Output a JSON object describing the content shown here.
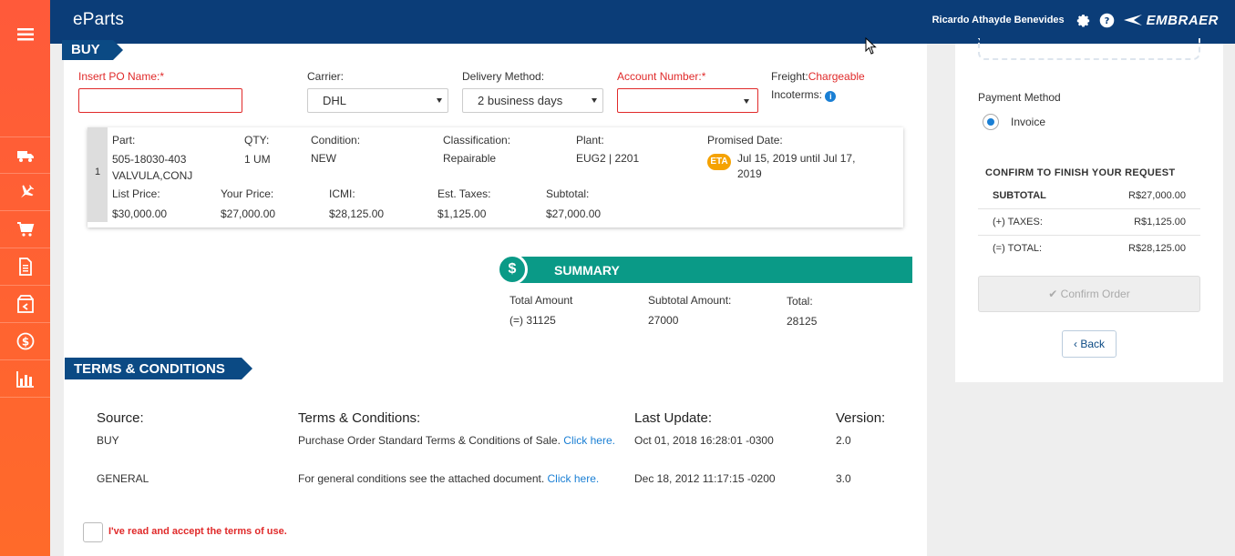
{
  "header": {
    "brand": "eParts",
    "user_name": "Ricardo Athayde Benevides",
    "company": "EMBRAER"
  },
  "sidebar": {
    "items": [
      {
        "icon": "menu-icon"
      },
      {
        "icon": "truck-icon"
      },
      {
        "icon": "airplane-icon"
      },
      {
        "icon": "cart-icon"
      },
      {
        "icon": "document-icon"
      },
      {
        "icon": "return-box-icon"
      },
      {
        "icon": "dollar-icon"
      },
      {
        "icon": "bar-chart-icon"
      }
    ]
  },
  "buy": {
    "section_title": "BUY",
    "po_label": "Insert PO Name:*",
    "po_value": "",
    "carrier_label": "Carrier:",
    "carrier_value": "DHL",
    "delivery_label": "Delivery Method:",
    "delivery_value": "2 business days",
    "account_label": "Account Number:*",
    "account_value": "",
    "freight_label": "Freight:",
    "freight_value": "Chargeable",
    "incoterms_label": "Incoterms:"
  },
  "part": {
    "index": "1",
    "part_label": "Part:",
    "part_number": "505-18030-403",
    "part_name": "VALVULA,CONJ",
    "qty_label": "QTY:",
    "qty_value": "1 UM",
    "condition_label": "Condition:",
    "condition_value": "NEW",
    "classification_label": "Classification:",
    "classification_value": "Repairable",
    "plant_label": "Plant:",
    "plant_value": "EUG2 | 2201",
    "promised_label": "Promised Date:",
    "eta_badge": "ETA",
    "promised_line1": "Jul 15, 2019 until Jul 17,",
    "promised_line2": "2019",
    "list_price_label": "List Price:",
    "list_price_value": "$30,000.00",
    "your_price_label": "Your Price:",
    "your_price_value": "$27,000.00",
    "icmi_label": "ICMI:",
    "icmi_value": "$28,125.00",
    "est_taxes_label": "Est. Taxes:",
    "est_taxes_value": "$1,125.00",
    "subtotal_label": "Subtotal:",
    "subtotal_value": "$27,000.00"
  },
  "summary": {
    "title": "SUMMARY",
    "total_amount_label": "Total Amount",
    "total_amount_value": "(=) 31125",
    "subtotal_amount_label": "Subtotal Amount:",
    "subtotal_amount_value": "27000",
    "total_label": "Total:",
    "total_value": "28125"
  },
  "terms": {
    "section_title": "TERMS & CONDITIONS",
    "headers": {
      "source": "Source:",
      "terms": "Terms & Conditions:",
      "last_update": "Last Update:",
      "version": "Version:"
    },
    "rows": [
      {
        "source": "BUY",
        "text": "Purchase Order Standard Terms & Conditions of Sale.",
        "link": "Click here.",
        "last_update": "Oct 01, 2018 16:28:01 -0300",
        "version": "2.0"
      },
      {
        "source": "GENERAL",
        "text": "For general conditions see the attached document.",
        "link": "Click here.",
        "last_update": "Dec 18, 2012 11:17:15 -0200",
        "version": "3.0"
      }
    ],
    "accept_label": "I've read and accept the terms of use."
  },
  "right_panel": {
    "payment_method_label": "Payment Method",
    "payment_option": "Invoice",
    "confirm_title": "CONFIRM TO FINISH YOUR REQUEST",
    "subtotal_label": "SUBTOTAL",
    "subtotal_value": "R$27,000.00",
    "taxes_label": "(+) TAXES:",
    "taxes_value": "R$1,125.00",
    "total_label": "(=) TOTAL:",
    "total_value": "R$28,125.00",
    "confirm_button": "✔ Confirm Order",
    "back_button": "Back"
  },
  "colors": {
    "header": "#0b3d78",
    "sidebar": "#ff5a3a",
    "summary": "#0a9a87",
    "required": "#e02a2a",
    "link": "#1a7fd4"
  }
}
